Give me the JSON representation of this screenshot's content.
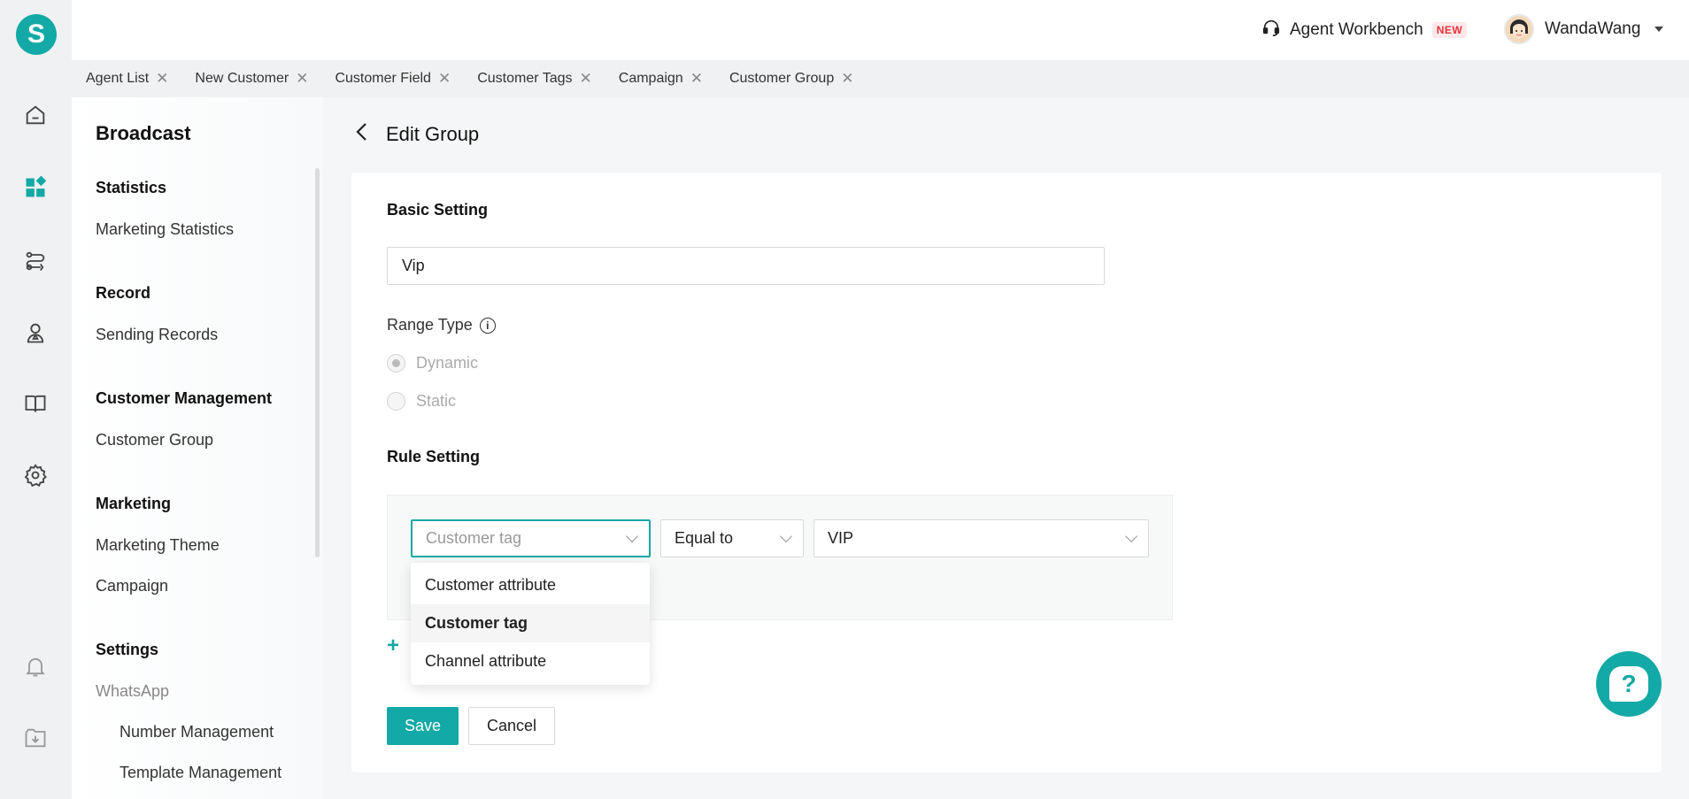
{
  "brand": {
    "logo_letter": "S",
    "accent": "#13a9a6"
  },
  "rail": {
    "icons": [
      "home-icon",
      "apps-icon",
      "route-icon",
      "contacts-icon",
      "book-icon",
      "gear-icon",
      "bell-icon",
      "download-icon"
    ]
  },
  "header": {
    "workbench_label": "Agent Workbench",
    "workbench_badge": "NEW",
    "user_name": "WandaWang"
  },
  "tabs": [
    {
      "label": "Agent List"
    },
    {
      "label": "New Customer"
    },
    {
      "label": "Customer Field"
    },
    {
      "label": "Customer Tags"
    },
    {
      "label": "Campaign"
    },
    {
      "label": "Customer Group"
    }
  ],
  "subnav": {
    "title": "Broadcast",
    "sections": {
      "statistics": "Statistics",
      "marketing_statistics": "Marketing Statistics",
      "record": "Record",
      "sending_records": "Sending Records",
      "customer_management": "Customer Management",
      "customer_group": "Customer Group",
      "marketing": "Marketing",
      "marketing_theme": "Marketing Theme",
      "campaign": "Campaign",
      "settings": "Settings",
      "whatsapp": "WhatsApp",
      "number_management": "Number Management",
      "template_management": "Template Management"
    }
  },
  "main": {
    "title": "Edit Group",
    "basic_setting": "Basic Setting",
    "group_name_value": "Vip",
    "range_type_label": "Range Type",
    "range_options": {
      "dynamic": "Dynamic",
      "static": "Static"
    },
    "rule_setting": "Rule Setting",
    "rule": {
      "field_placeholder": "Customer tag",
      "operator": "Equal to",
      "value": "VIP"
    },
    "dropdown_options": [
      "Customer attribute",
      "Customer tag",
      "Channel attribute"
    ],
    "save_label": "Save",
    "cancel_label": "Cancel"
  }
}
